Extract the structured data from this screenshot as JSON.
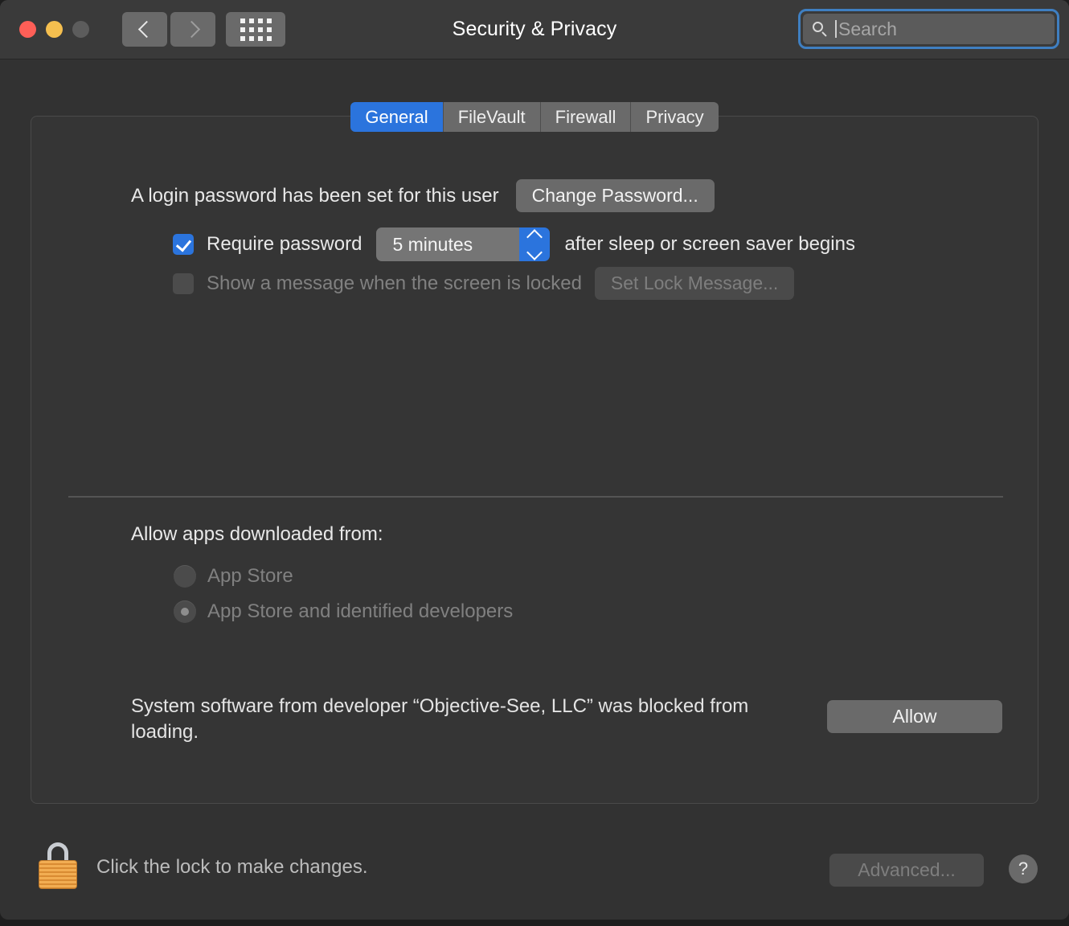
{
  "window": {
    "title": "Security & Privacy",
    "traffic_lights": [
      "close",
      "minimize",
      "zoom"
    ],
    "nav": {
      "back": "back-icon",
      "forward": "forward-icon",
      "show_all": "grid-icon"
    }
  },
  "search": {
    "placeholder": "Search",
    "value": "",
    "icon": "search-icon",
    "focused": true,
    "focus_ring_color": "#3f7fc1"
  },
  "tabs": [
    {
      "label": "General",
      "active": true
    },
    {
      "label": "FileVault",
      "active": false
    },
    {
      "label": "Firewall",
      "active": false
    },
    {
      "label": "Privacy",
      "active": false
    }
  ],
  "general": {
    "password_status": "A login password has been set for this user",
    "change_password_label": "Change Password...",
    "require_password": {
      "label": "Require password",
      "checked": true,
      "interval": "5 minutes",
      "suffix": "after sleep or screen saver begins"
    },
    "lock_message": {
      "label": "Show a message when the screen is locked",
      "checked": false,
      "enabled": false,
      "button_label": "Set Lock Message..."
    },
    "allow_apps": {
      "heading": "Allow apps downloaded from:",
      "enabled": false,
      "options": [
        {
          "label": "App Store",
          "selected": false
        },
        {
          "label": "App Store and identified developers",
          "selected": true
        }
      ]
    },
    "blocked_notice": {
      "text": "System software from developer “Objective-See, LLC” was blocked from loading.",
      "button_label": "Allow"
    }
  },
  "footer": {
    "lock_icon": "lock-closed-icon",
    "lock_text": "Click the lock to make changes.",
    "advanced_label": "Advanced...",
    "advanced_enabled": false,
    "help_label": "?"
  },
  "colors": {
    "accent_blue": "#2b74dd",
    "window_bg": "#323232",
    "titlebar_bg": "#3a3a3a",
    "panel_bg": "#353535",
    "control_gray": "#6a6a6a",
    "lock_gold": "#f2ad52"
  }
}
